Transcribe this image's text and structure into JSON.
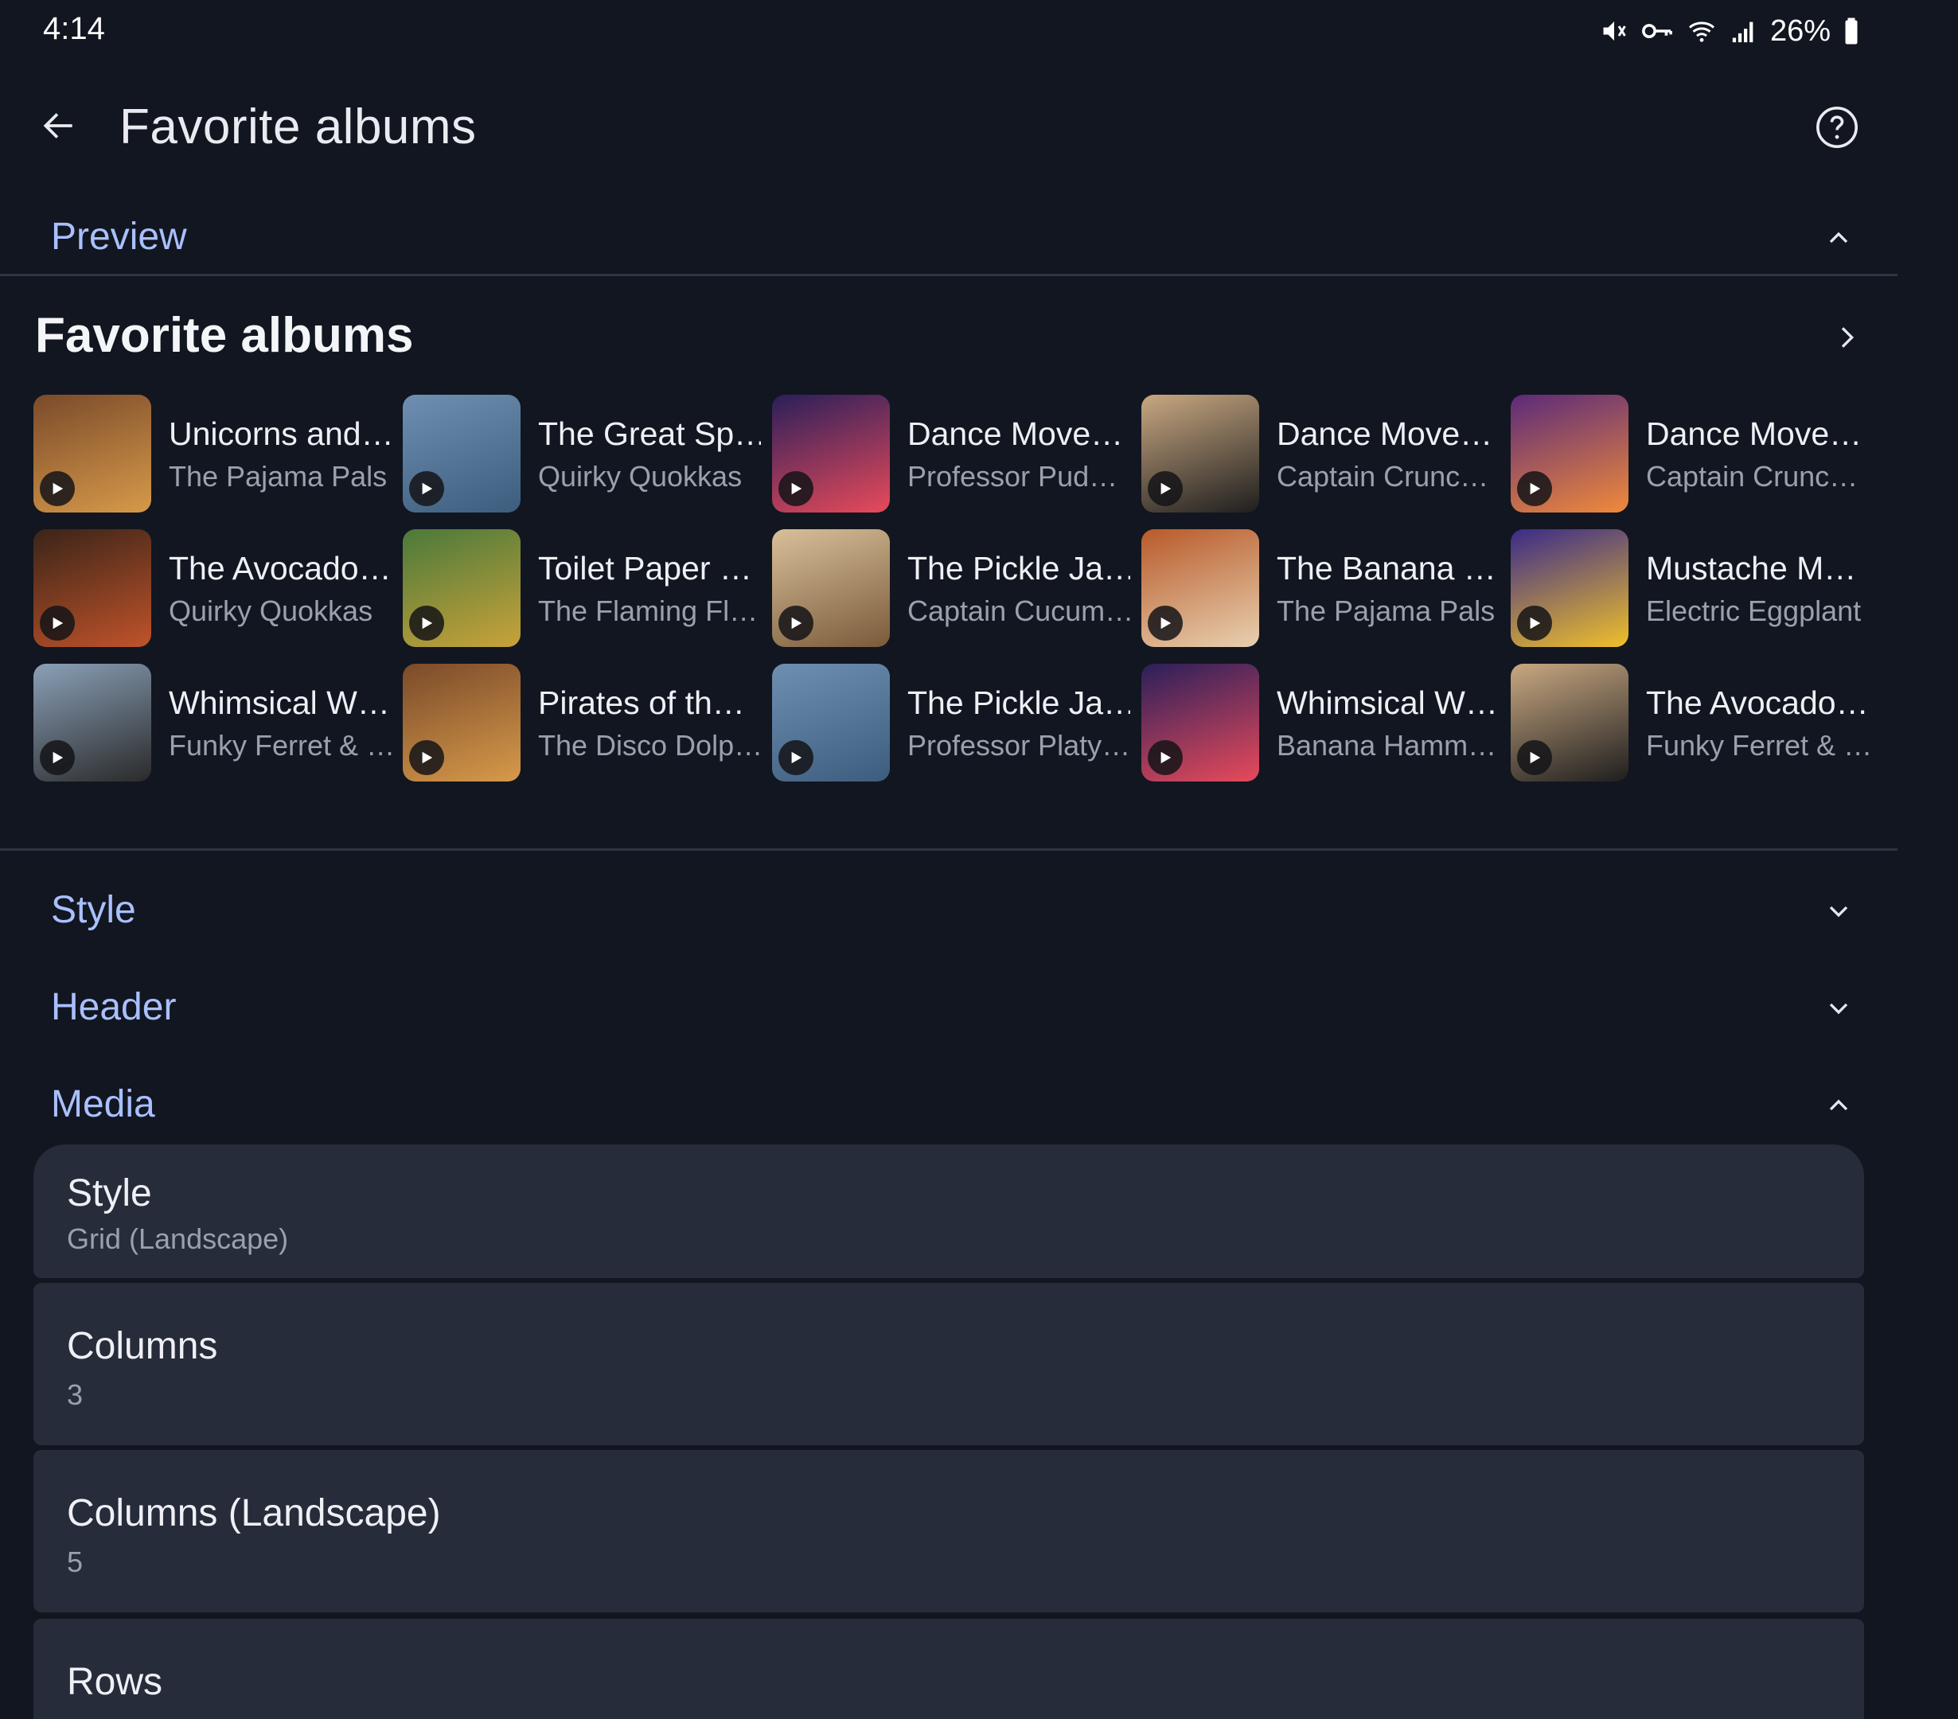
{
  "status_bar": {
    "time": "4:14",
    "battery": "26%"
  },
  "app_bar": {
    "title": "Favorite albums"
  },
  "sections": {
    "preview": "Preview",
    "style": "Style",
    "header": "Header",
    "media": "Media"
  },
  "preview": {
    "title": "Favorite albums",
    "albums": [
      {
        "title": "Unicorns and…",
        "artist": "The Pajama Pals",
        "art": [
          "#7a4a2a",
          "#d79a4a"
        ]
      },
      {
        "title": "The Great Sp…",
        "artist": "Quirky Quokkas",
        "art": [
          "#6f8fb2",
          "#3c5d7d"
        ]
      },
      {
        "title": "Dance Move…",
        "artist": "Professor Pud…",
        "art": [
          "#2a1f5a",
          "#e84a5a"
        ]
      },
      {
        "title": "Dance Move…",
        "artist": "Captain Crunc…",
        "art": [
          "#c9a882",
          "#1e1e1e"
        ]
      },
      {
        "title": "Dance Move…",
        "artist": "Captain Crunc…",
        "art": [
          "#5b2a7a",
          "#f08a3a"
        ]
      },
      {
        "title": "The Avocado…",
        "artist": "Quirky Quokkas",
        "art": [
          "#3a2418",
          "#c0532a"
        ]
      },
      {
        "title": "Toilet Paper …",
        "artist": "The Flaming Fl…",
        "art": [
          "#4a7a3a",
          "#c9a23a"
        ]
      },
      {
        "title": "The Pickle Ja…",
        "artist": "Captain Cucum…",
        "art": [
          "#d8c09a",
          "#7a5a3a"
        ]
      },
      {
        "title": "The Banana …",
        "artist": "The Pajama Pals",
        "art": [
          "#b85a2a",
          "#e8d0b0"
        ]
      },
      {
        "title": "Mustache M…",
        "artist": "Electric Eggplant",
        "art": [
          "#3a2a8a",
          "#f0c02a"
        ]
      },
      {
        "title": "Whimsical W…",
        "artist": "Funky Ferret & …",
        "art": [
          "#8aa0b8",
          "#2a2a2a"
        ]
      },
      {
        "title": "Pirates of th…",
        "artist": "The Disco Dolp…",
        "art": [
          "#7a4a2a",
          "#d79a4a"
        ]
      },
      {
        "title": "The Pickle Ja…",
        "artist": "Professor Platy…",
        "art": [
          "#6f8fb2",
          "#3c5d7d"
        ]
      },
      {
        "title": "Whimsical W…",
        "artist": "Banana Hamm…",
        "art": [
          "#2a1f5a",
          "#e84a5a"
        ]
      },
      {
        "title": "The Avocado…",
        "artist": "Funky Ferret & …",
        "art": [
          "#c9a882",
          "#1e1e1e"
        ]
      }
    ]
  },
  "media_settings": [
    {
      "title": "Style",
      "value": "Grid (Landscape)"
    },
    {
      "title": "Columns",
      "value": "3"
    },
    {
      "title": "Columns (Landscape)",
      "value": "5"
    },
    {
      "title": "Rows",
      "value": ""
    }
  ],
  "colors": {
    "background": "#121620",
    "accent": "#a9c0ff",
    "card": "#272c3a",
    "secondary_text": "#9aa0ad"
  }
}
